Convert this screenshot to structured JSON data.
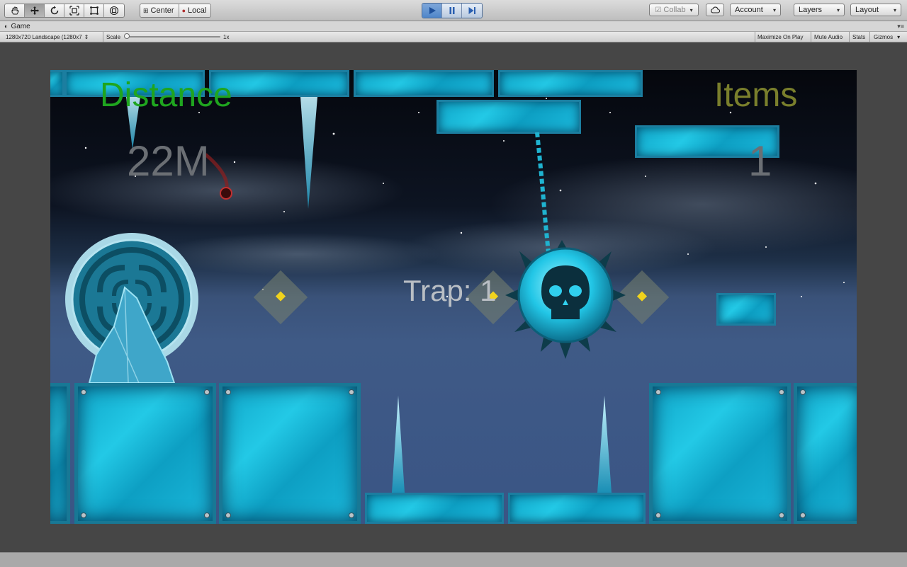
{
  "toolbar": {
    "tools": [
      "hand-tool",
      "move-tool",
      "rotate-tool",
      "scale-tool",
      "rect-tool",
      "transform-tool"
    ],
    "pivot_center": "Center",
    "pivot_local": "Local",
    "collab_label": "Collab",
    "account_label": "Account",
    "layers_label": "Layers",
    "layout_label": "Layout"
  },
  "game_view": {
    "tab_label": "Game",
    "resolution": "1280x720 Landscape (1280x7",
    "scale_label": "Scale",
    "scale_value": "1x",
    "scale_level": 0,
    "maximize_on_play": "Maximize On Play",
    "mute_audio": "Mute Audio",
    "stats": "Stats",
    "gizmos": "Gizmos"
  },
  "hud": {
    "distance_label": "Distance",
    "distance_value": "22M",
    "items_label": "Items",
    "items_value": "1",
    "trap_label": "Trap: 1"
  },
  "colors": {
    "distance": "#1fa51f",
    "items": "#7a7f2c",
    "hud_value": "#6b6f74",
    "trap": "#b9bec4",
    "ice_block": "#1bb9dc"
  }
}
